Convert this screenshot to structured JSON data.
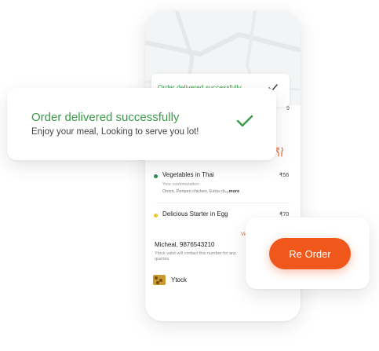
{
  "notification": {
    "title": "Order delivered successfully",
    "subtitle": "Enjoy your meal, Looking to serve you lot!"
  },
  "map": {
    "digit": "9"
  },
  "order_items": [
    {
      "name": "Vegetables in Thai",
      "price": "₹56",
      "customization_label": "Your customization:",
      "customization_value": "Onion, Periperi chicken, Extra ch",
      "more_label": "...more",
      "dot_color": "#2e8b57"
    },
    {
      "name": "Delicious Starter in Egg",
      "price": "₹70",
      "dot_color": "#e8c531"
    }
  ],
  "view_link": "View",
  "contact": {
    "name": "Micheal, 9876543210",
    "note_line1": "Ytock valet will contact this number for any",
    "note_line2": "queries."
  },
  "restaurant": {
    "name": "Ytock"
  },
  "reorder_label": "Re Order",
  "colors": {
    "success_green": "#3a9a4a",
    "accent_orange": "#f0571b"
  },
  "icons": [
    "check-icon",
    "restaurant-icon"
  ]
}
